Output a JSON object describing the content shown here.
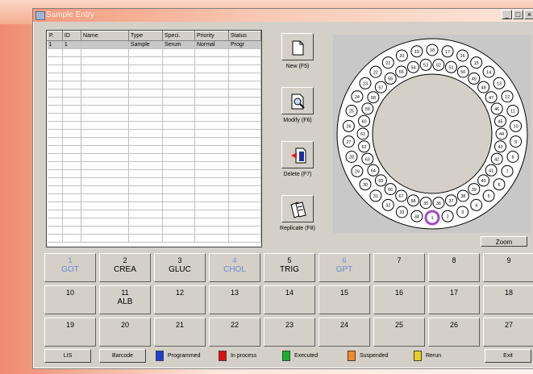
{
  "window": {
    "title": "Sample Entry"
  },
  "table": {
    "headers": [
      "P.",
      "ID",
      "Name",
      "Type",
      "Speci.",
      "Priority",
      "Status"
    ],
    "rows": [
      [
        "1",
        "1",
        "",
        "Sample",
        "Serum",
        "Normal",
        "Progr"
      ]
    ]
  },
  "actions": {
    "new": "New (F5)",
    "modify": "Modify (F6)",
    "delete": "Delete (F7)",
    "replicate": "Replicate (F8)"
  },
  "zoom": "Zoom",
  "tests": [
    {
      "num": "1",
      "name": "GOT",
      "color": "blue"
    },
    {
      "num": "2",
      "name": "CREA",
      "color": "black"
    },
    {
      "num": "3",
      "name": "GLUC",
      "color": "black"
    },
    {
      "num": "4",
      "name": "CHOL",
      "color": "blue"
    },
    {
      "num": "5",
      "name": "TRIG",
      "color": "black"
    },
    {
      "num": "6",
      "name": "GPT",
      "color": "blue"
    },
    {
      "num": "7",
      "name": "",
      "color": "black"
    },
    {
      "num": "8",
      "name": "",
      "color": "black"
    },
    {
      "num": "9",
      "name": "",
      "color": "black"
    },
    {
      "num": "10",
      "name": "",
      "color": "black"
    },
    {
      "num": "11",
      "name": "ALB",
      "color": "black"
    },
    {
      "num": "12",
      "name": "",
      "color": "black"
    },
    {
      "num": "13",
      "name": "",
      "color": "black"
    },
    {
      "num": "14",
      "name": "",
      "color": "black"
    },
    {
      "num": "15",
      "name": "",
      "color": "black"
    },
    {
      "num": "16",
      "name": "",
      "color": "black"
    },
    {
      "num": "17",
      "name": "",
      "color": "black"
    },
    {
      "num": "18",
      "name": "",
      "color": "black"
    },
    {
      "num": "19",
      "name": "",
      "color": "black"
    },
    {
      "num": "20",
      "name": "",
      "color": "black"
    },
    {
      "num": "21",
      "name": "",
      "color": "black"
    },
    {
      "num": "22",
      "name": "",
      "color": "black"
    },
    {
      "num": "23",
      "name": "",
      "color": "black"
    },
    {
      "num": "24",
      "name": "",
      "color": "black"
    },
    {
      "num": "25",
      "name": "",
      "color": "black"
    },
    {
      "num": "26",
      "name": "",
      "color": "black"
    },
    {
      "num": "27",
      "name": "",
      "color": "black"
    }
  ],
  "bottom": {
    "lis": "LIS",
    "barcode": "Barcode",
    "exit": "Exit",
    "legend": [
      {
        "label": "Programmed",
        "color": "#1f3fd0"
      },
      {
        "label": "In process",
        "color": "#e01010"
      },
      {
        "label": "Executed",
        "color": "#18b030"
      },
      {
        "label": "Suspended",
        "color": "#f08a2a"
      },
      {
        "label": "Rerun",
        "color": "#e8d020"
      }
    ]
  },
  "rotor": {
    "positions": 68,
    "selected": "1",
    "selected_color": "#9a4fc0"
  },
  "colors": {
    "test_programmed_text": "#6f88d4"
  }
}
